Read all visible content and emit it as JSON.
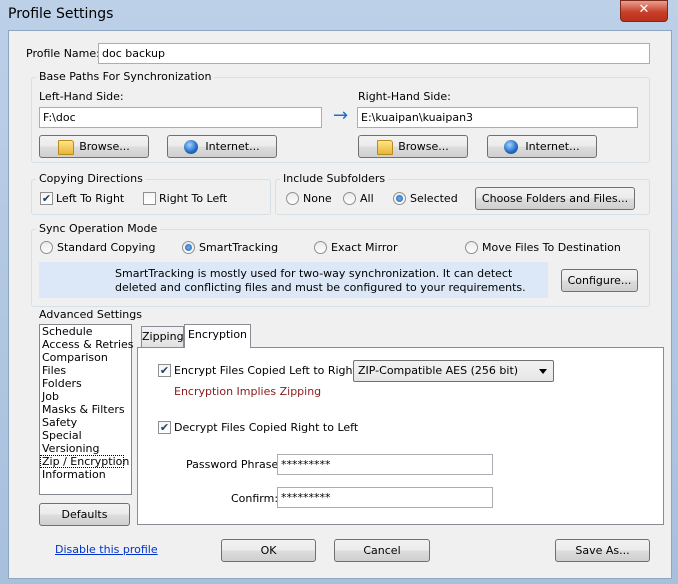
{
  "window": {
    "title": "Profile Settings",
    "close_glyph": "✕"
  },
  "profile": {
    "label": "Profile Name:",
    "value": "doc backup"
  },
  "base_paths": {
    "group_label": "Base Paths For Synchronization",
    "left_label": "Left-Hand Side:",
    "left_value": "F:\\doc",
    "right_label": "Right-Hand Side:",
    "right_value": "E:\\kuaipan\\kuaipan3",
    "arrow": "→",
    "browse": "Browse...",
    "internet": "Internet..."
  },
  "copy_dir": {
    "label": "Copying Directions",
    "ltr": "Left To Right",
    "rtl": "Right To Left",
    "ltr_checked": true,
    "rtl_checked": false
  },
  "subfolders": {
    "label": "Include Subfolders",
    "none": "None",
    "all": "All",
    "selected": "Selected",
    "choose": "Choose Folders and Files...",
    "value": "Selected"
  },
  "sync_mode": {
    "label": "Sync Operation Mode",
    "options": [
      "Standard Copying",
      "SmartTracking",
      "Exact Mirror",
      "Move Files To Destination"
    ],
    "selected": "SmartTracking",
    "info_line1": "SmartTracking is mostly used for two-way synchronization. It can detect",
    "info_line2": "deleted and conflicting files and must be configured to your requirements.",
    "configure": "Configure..."
  },
  "advanced": {
    "label": "Advanced Settings",
    "items": [
      "Schedule",
      "Access & Retries",
      "Comparison",
      "Files",
      "Folders",
      "Job",
      "Masks & Filters",
      "Safety",
      "Special",
      "Versioning",
      "Zip / Encryption",
      "Information"
    ],
    "selected": "Zip / Encryption",
    "defaults": "Defaults"
  },
  "tabs": {
    "zipping": "Zipping",
    "encryption": "Encryption",
    "active": "Encryption"
  },
  "encryption": {
    "encrypt_label": "Encrypt Files Copied Left to Right:",
    "encrypt_checked": true,
    "method": "ZIP-Compatible AES (256 bit)",
    "note": "Encryption Implies Zipping",
    "decrypt_label": "Decrypt Files Copied Right to Left",
    "decrypt_checked": true,
    "password_label": "Password Phrase:",
    "password_value": "*********",
    "confirm_label": "Confirm:",
    "confirm_value": "*********"
  },
  "footer": {
    "disable": "Disable this profile",
    "ok": "OK",
    "cancel": "Cancel",
    "save_as": "Save As..."
  },
  "colors": {
    "info_bg": "#dce8f7",
    "link": "#0033cc",
    "note": "#8b1a1a",
    "accent": "#1e5aa8"
  }
}
